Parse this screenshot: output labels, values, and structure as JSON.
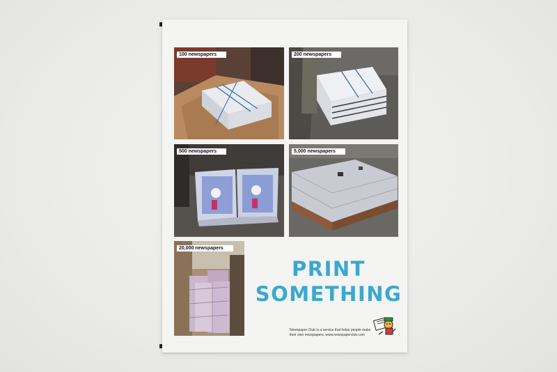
{
  "photos": [
    {
      "id": "p100",
      "label": "100 newspapers"
    },
    {
      "id": "p200",
      "label": "200 newspapers"
    },
    {
      "id": "p500",
      "label": "500 newspapers"
    },
    {
      "id": "p5000",
      "label": "5,000 newspapers"
    },
    {
      "id": "p20000",
      "label": "20,000 newspapers"
    }
  ],
  "headline": {
    "line1": "PRINT",
    "line2": "SOMETHING"
  },
  "footer": {
    "line1": "Newspaper Club is a service that helps people make",
    "line2": "their own newspapers. www.newspaperclub.com"
  },
  "colors": {
    "headline": "#3aa8cf",
    "sheet": "#f4f4f2",
    "backdrop": "#ececea"
  },
  "icons": {
    "mascot": "newspaper-club-mascot-icon"
  }
}
